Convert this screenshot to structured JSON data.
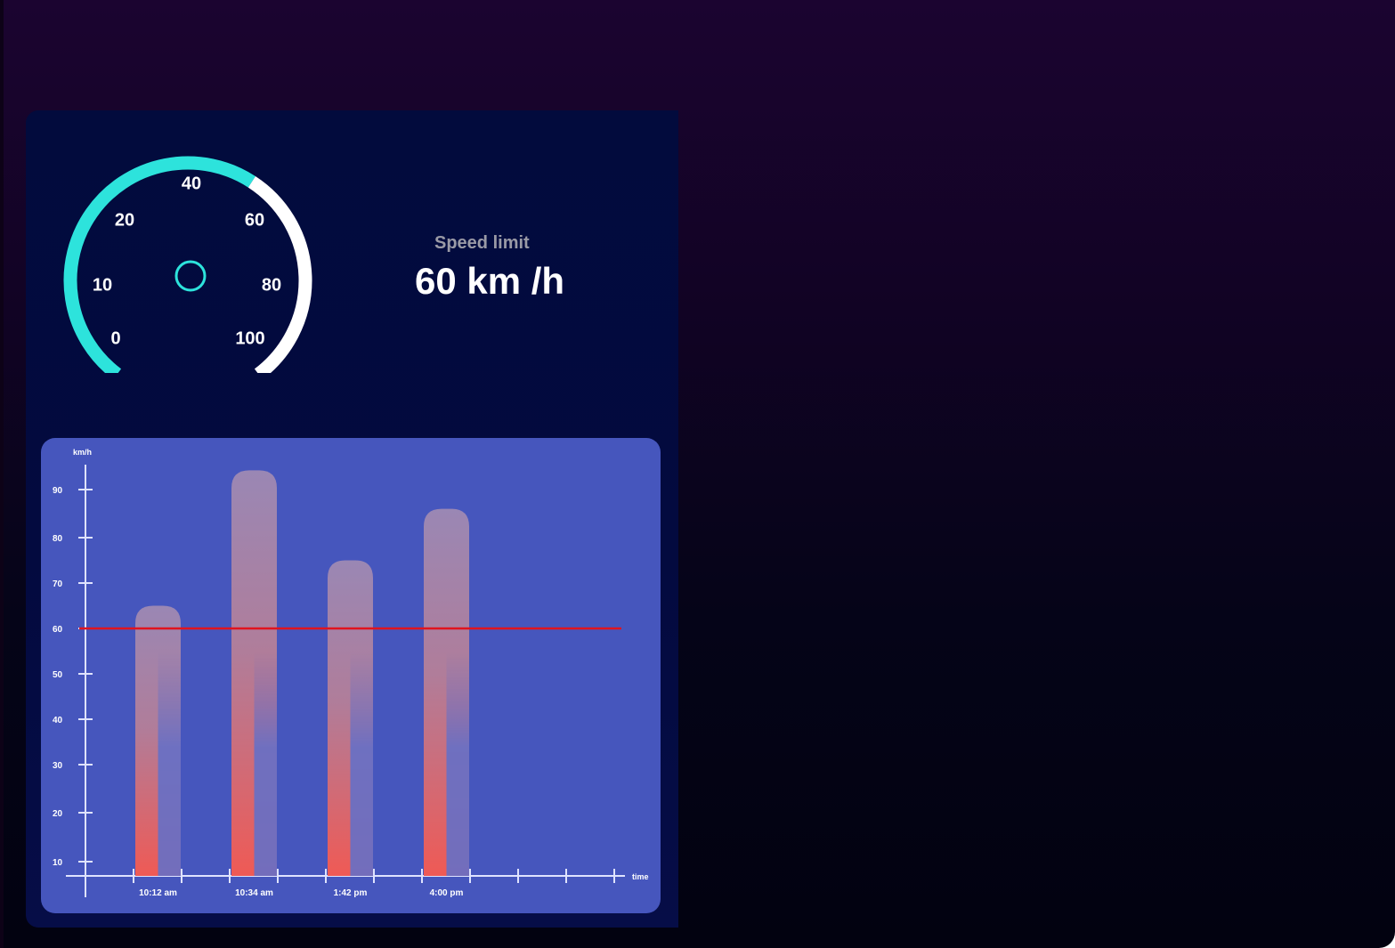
{
  "colors": {
    "gauge_active": "#2de3dc",
    "gauge_inactive": "#ffffff",
    "limit_line": "#e0141e",
    "bar_top": "#9a87b4",
    "bar_bottom": "#ef5a55",
    "card": "#4656bd"
  },
  "gauge": {
    "labels": [
      "0",
      "10",
      "20",
      "40",
      "60",
      "80",
      "100"
    ],
    "needle_icon": "hub-circle-icon"
  },
  "speed_limit": {
    "title": "Speed limit",
    "value": "60 km /h"
  },
  "chart_data": {
    "type": "bar",
    "ylabel": "km/h",
    "xlabel": "time",
    "yticks": [
      10,
      20,
      30,
      40,
      50,
      60,
      70,
      80,
      90
    ],
    "categories": [
      "10:12 am",
      "10:34 am",
      "1:42 pm",
      "4:00 pm"
    ],
    "values": [
      65,
      94,
      75,
      86
    ],
    "limit": 60,
    "x_slots": 11
  }
}
